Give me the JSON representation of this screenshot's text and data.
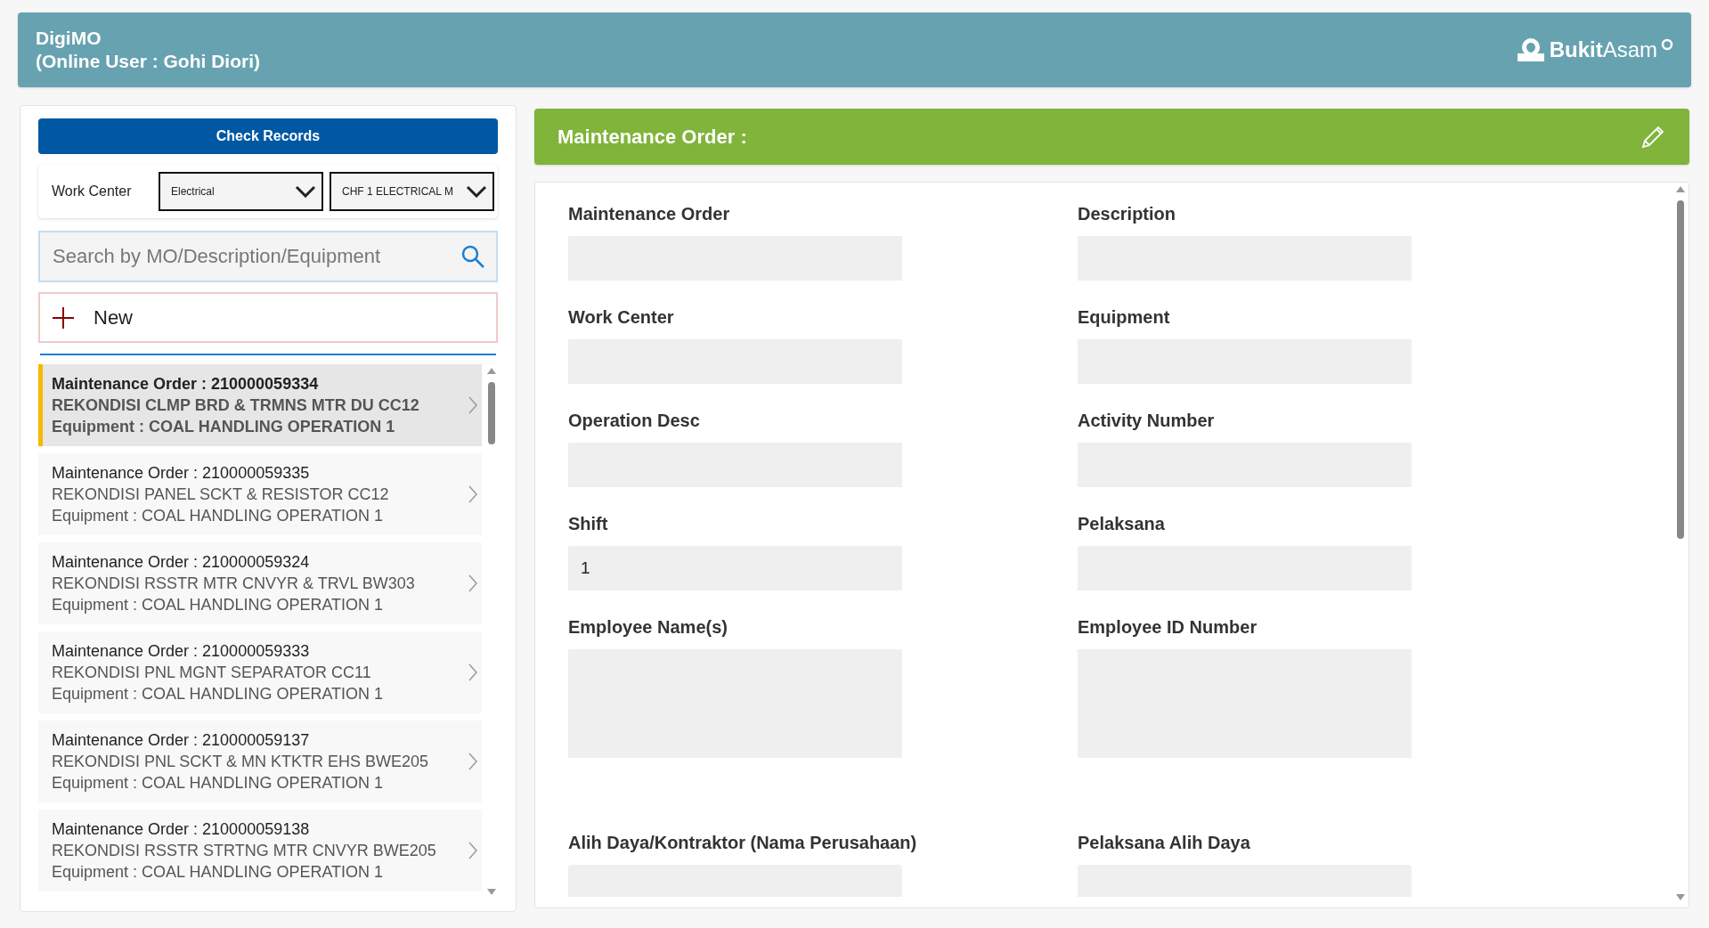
{
  "header": {
    "app_name": "DigiMO",
    "online_user": "(Online User : Gohi Diori)",
    "logo_text": "**Bukit**Asam"
  },
  "sidebar": {
    "check_button": "Check Records",
    "work_center_label": "Work Center",
    "dropdowns": [
      {
        "value": "Electrical"
      },
      {
        "value": "CHF 1 ELECTRICAL M"
      }
    ],
    "search": {
      "placeholder": "Search by MO/Description/Equipment"
    },
    "new_button": "New",
    "orders": [
      {
        "title": "Maintenance Order : 210000059334",
        "description": "REKONDISI CLMP BRD & TRMNS MTR DU CC12",
        "equipment": "Equipment : COAL HANDLING OPERATION 1",
        "selected": true
      },
      {
        "title": "Maintenance Order : 210000059335",
        "description": "REKONDISI PANEL SCKT & RESISTOR CC12",
        "equipment": "Equipment : COAL HANDLING OPERATION 1",
        "selected": false
      },
      {
        "title": "Maintenance Order : 210000059324",
        "description": "REKONDISI RSSTR MTR CNVYR & TRVL BW303",
        "equipment": "Equipment : COAL HANDLING OPERATION 1",
        "selected": false
      },
      {
        "title": "Maintenance Order : 210000059333",
        "description": "REKONDISI PNL MGNT SEPARATOR CC11",
        "equipment": "Equipment : COAL HANDLING OPERATION 1",
        "selected": false
      },
      {
        "title": "Maintenance Order : 210000059137",
        "description": "REKONDISI PNL SCKT & MN KTKTR EHS BWE205",
        "equipment": "Equipment : COAL HANDLING OPERATION 1",
        "selected": false
      },
      {
        "title": "Maintenance Order : 210000059138",
        "description": "REKONDISI RSSTR STRTNG MTR CNVYR BWE205",
        "equipment": "Equipment : COAL HANDLING OPERATION 1",
        "selected": false
      }
    ]
  },
  "detail": {
    "title": "Maintenance Order :",
    "fields": [
      {
        "label": "Maintenance Order",
        "kind": "line"
      },
      {
        "label": "Description",
        "kind": "line"
      },
      {
        "label": "Work Center",
        "kind": "line"
      },
      {
        "label": "Equipment",
        "kind": "line"
      },
      {
        "label": "Operation Desc",
        "kind": "line"
      },
      {
        "label": "Activity Number",
        "kind": "line"
      },
      {
        "label": "Shift",
        "kind": "line",
        "value": "1"
      },
      {
        "label": "Pelaksana",
        "kind": "line"
      },
      {
        "label": "Employee Name(s)",
        "kind": "area"
      },
      {
        "label": "Employee ID Number",
        "kind": "area"
      },
      {
        "label": "Alih Daya/Kontraktor (Nama Perusahaan)",
        "kind": "cut"
      },
      {
        "label": "Pelaksana Alih Daya",
        "kind": "cut"
      }
    ]
  }
}
